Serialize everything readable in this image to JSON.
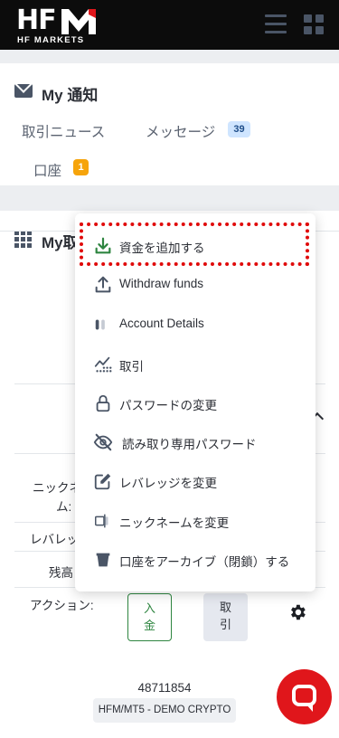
{
  "header": {
    "logo_main": "HF",
    "logo_sub": "HF MARKETS"
  },
  "notifications": {
    "title": "My 通知",
    "tabs": [
      {
        "label": "取引ニュース",
        "count": ""
      },
      {
        "label": "メッセージ",
        "count": "39"
      },
      {
        "label": "口座",
        "count": "1"
      }
    ]
  },
  "accounts": {
    "title_visible": "My取",
    "row_labels": [
      "ニックネー",
      "ム:",
      "レバレッ",
      "残高",
      "アクション:"
    ],
    "deposit_label_line1": "入",
    "deposit_label_line2": "金",
    "trade_label_line1": "取",
    "trade_label_line2": "引",
    "account_number": "48711854",
    "account_type": "HFM/MT5 - DEMO CRYPTO"
  },
  "dropdown": {
    "items": [
      {
        "label": "資金を追加する",
        "icon": "download-icon"
      },
      {
        "label": "Withdraw funds",
        "icon": "upload-icon"
      },
      {
        "label": "Account Details",
        "icon": "info-icon"
      },
      {
        "label": "取引",
        "icon": "trend-icon"
      },
      {
        "label": "パスワードの変更",
        "icon": "lock-icon"
      },
      {
        "label": "読み取り専用パスワード",
        "icon": "eye-off-icon"
      },
      {
        "label": "レバレッジを変更",
        "icon": "edit-icon"
      },
      {
        "label": "ニックネームを変更",
        "icon": "rename-icon"
      },
      {
        "label": "口座をアーカイブ（閉鎖）する",
        "icon": "archive-icon"
      }
    ]
  },
  "colors": {
    "header_bg": "#0c0c0c",
    "accent_red": "#e0161b",
    "deposit_green": "#2e8540",
    "badge_orange": "#f6a40b",
    "badge_blue": "#cfe5ff"
  }
}
